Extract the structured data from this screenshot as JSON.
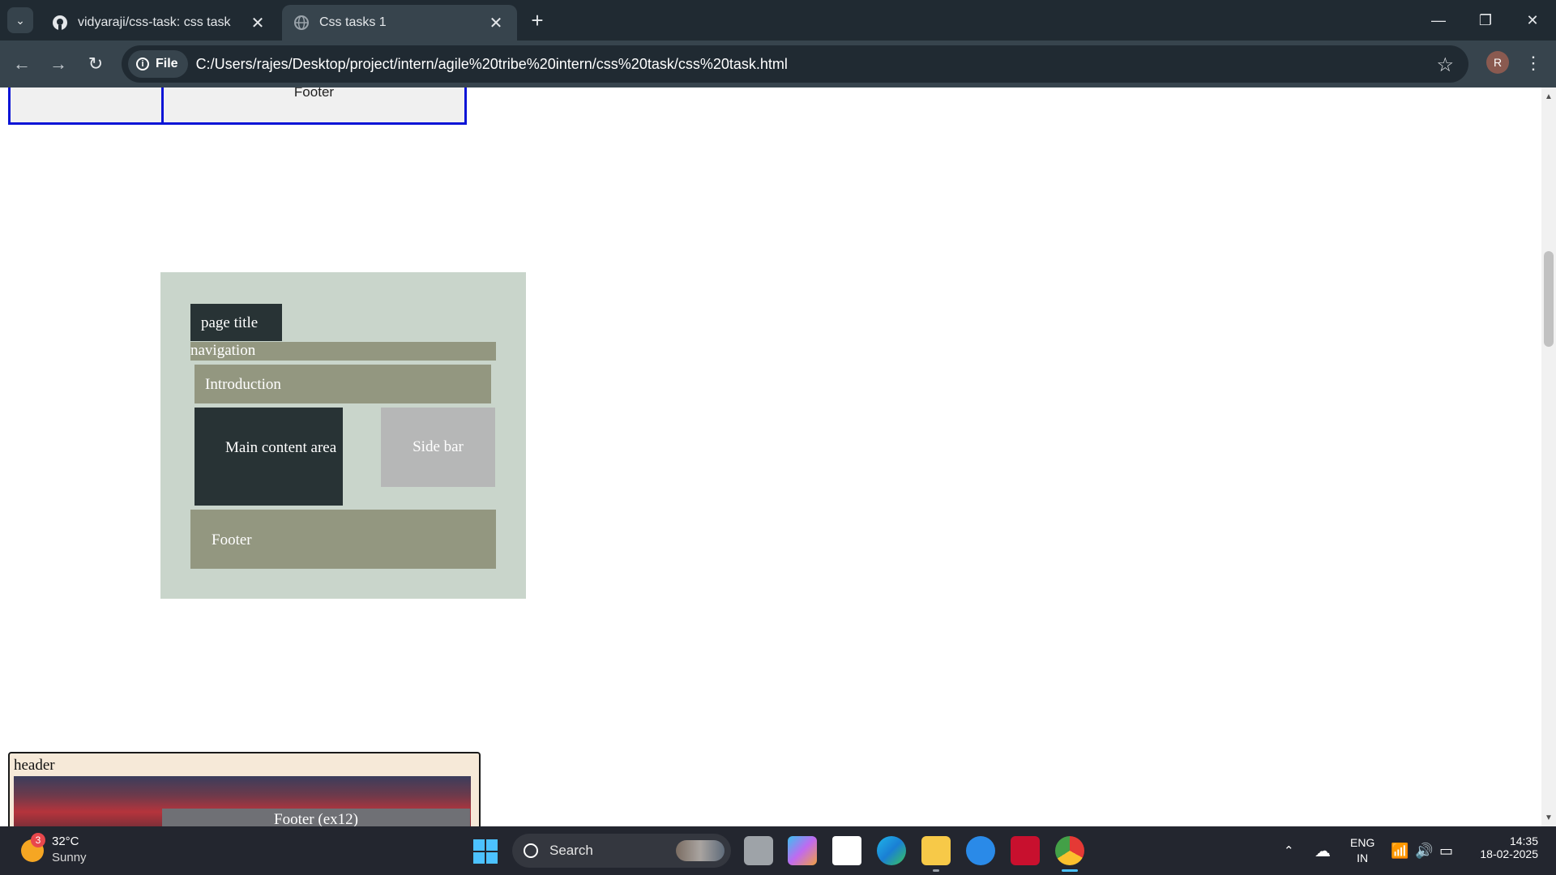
{
  "browser": {
    "tabs": [
      {
        "title": "vidyaraji/css-task: css task",
        "icon": "github-icon",
        "active": false
      },
      {
        "title": "Css tasks 1",
        "icon": "globe-icon",
        "active": true
      }
    ],
    "site_chip": "File",
    "url": "C:/Users/rajes/Desktop/project/intern/agile%20tribe%20intern/css%20task/css%20task.html",
    "profile_initial": "R"
  },
  "page": {
    "top_table": {
      "footer_cell": "Footer"
    },
    "grid_demo": {
      "page_title": "page title",
      "navigation": "navigation",
      "introduction": "Introduction",
      "main_content": "Main content area",
      "sidebar": "Side bar",
      "footer": "Footer"
    },
    "bottom_card": {
      "header": "header",
      "footer": "Footer (ex12)"
    }
  },
  "taskbar": {
    "weather": {
      "temp": "32°C",
      "desc": "Sunny",
      "badge": "3"
    },
    "search_label": "Search",
    "tray": {
      "lang_top": "ENG",
      "lang_bottom": "IN"
    },
    "clock": {
      "time": "14:35",
      "date": "18-02-2025"
    }
  },
  "colors": {
    "tabbar": "#202a32",
    "toolbar": "#37444d",
    "table_border": "#0a14d6",
    "grid_bg": "#c9d5cb",
    "dark_block": "#283335",
    "olive_block": "#939780",
    "sidebar_block": "#b6b7b7"
  }
}
